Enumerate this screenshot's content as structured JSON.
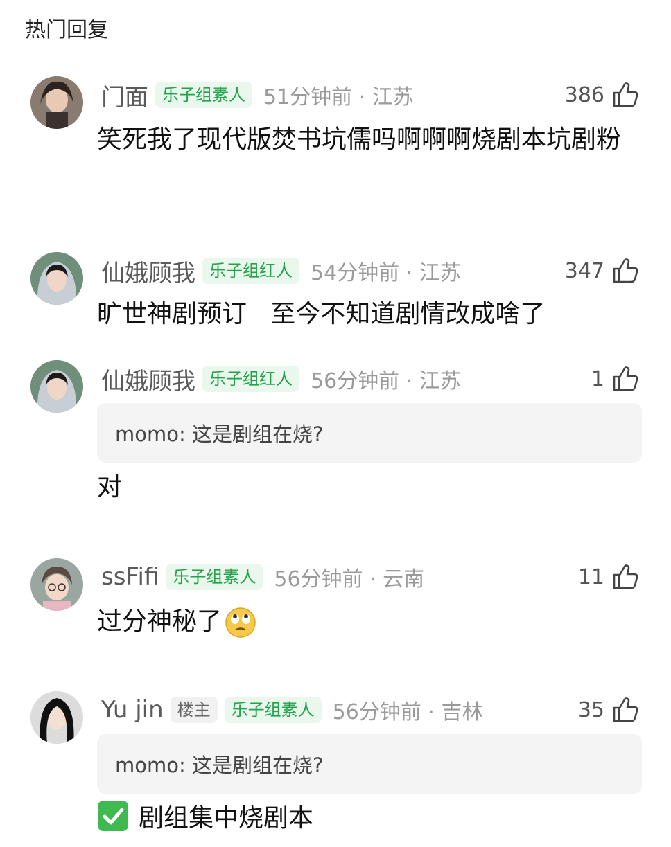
{
  "section_title": "热门回复",
  "comments": [
    {
      "username": "门面",
      "badge": "乐子组素人",
      "time": "51分钟前 · 江苏",
      "likes": "386",
      "text": "笑死我了现代版焚书坑儒吗啊啊啊烧剧本坑剧粉"
    },
    {
      "username": "仙娥顾我",
      "badge": "乐子组红人",
      "time": "54分钟前 · 江苏",
      "likes": "347",
      "text": "旷世神剧预订   至今不知道剧情改成啥了"
    },
    {
      "username": "仙娥顾我",
      "badge": "乐子组红人",
      "time": "56分钟前 · 江苏",
      "likes": "1",
      "quote": "momo: 这是剧组在烧?",
      "text": "对"
    },
    {
      "username": "ssFifi",
      "badge": "乐子组素人",
      "time": "56分钟前 · 云南",
      "likes": "11",
      "text": "过分神秘了",
      "emoji": "eye-roll-emoji"
    },
    {
      "username": "Yu jin",
      "owner_tag": "楼主",
      "badge": "乐子组素人",
      "time": "56分钟前 · 吉林",
      "likes": "35",
      "quote": "momo: 这是剧组在烧?",
      "text": "剧组集中烧剧本",
      "icon": "check-mark-icon"
    }
  ],
  "colors": {
    "badge_text": "#22a24a",
    "badge_bg": "#e9f7ec",
    "quote_bg": "#f4f4f4",
    "meta_text": "#9a9a9a"
  }
}
